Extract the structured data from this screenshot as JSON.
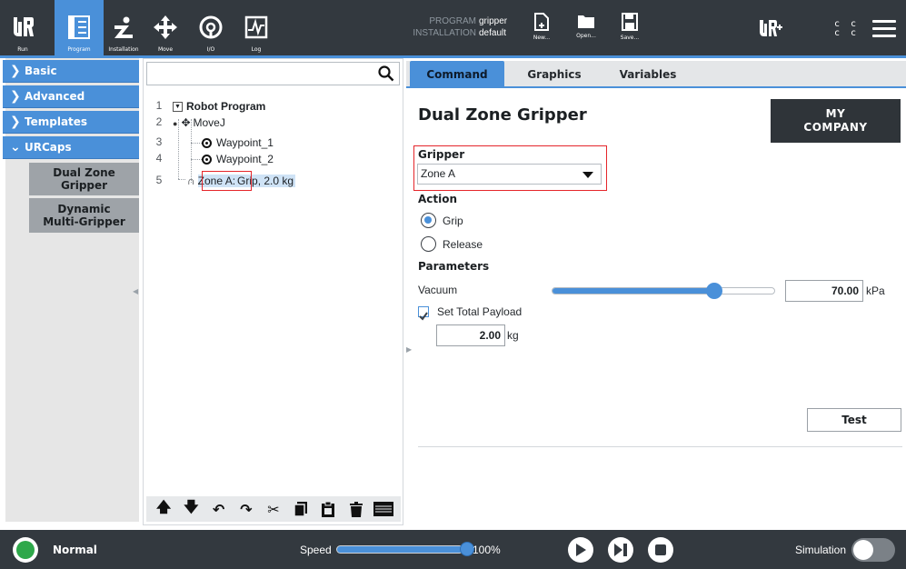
{
  "header": {
    "nav": [
      {
        "label": "Run",
        "icon": "ur-logo-icon"
      },
      {
        "label": "Program",
        "icon": "program-icon"
      },
      {
        "label": "Installation",
        "icon": "installation-icon"
      },
      {
        "label": "Move",
        "icon": "move-icon"
      },
      {
        "label": "I/O",
        "icon": "io-icon"
      },
      {
        "label": "Log",
        "icon": "log-icon"
      }
    ],
    "program_label": "PROGRAM",
    "program_value": "gripper",
    "installation_label": "INSTALLATION",
    "installation_value": "default",
    "file_buttons": [
      {
        "label": "New...",
        "icon": "new-file-icon"
      },
      {
        "label": "Open...",
        "icon": "open-folder-icon"
      },
      {
        "label": "Save...",
        "icon": "save-icon"
      }
    ],
    "cc_glyphs": [
      "c c",
      "c c"
    ]
  },
  "sidebar": {
    "categories": [
      {
        "label": "Basic",
        "expanded": false
      },
      {
        "label": "Advanced",
        "expanded": false
      },
      {
        "label": "Templates",
        "expanded": false
      },
      {
        "label": "URCaps",
        "expanded": true
      }
    ],
    "urcaps_items": [
      "Dual Zone Gripper",
      "Dynamic Multi-Gripper"
    ]
  },
  "tree": {
    "search_value": "",
    "rows": [
      {
        "num": "1",
        "text": "Robot Program"
      },
      {
        "num": "2",
        "text": "MoveJ"
      },
      {
        "num": "3",
        "text": "Waypoint_1"
      },
      {
        "num": "4",
        "text": "Waypoint_2"
      },
      {
        "num": "5",
        "zone_label": "Zone A:",
        "text": "Grip, 2.0 kg"
      }
    ]
  },
  "panel": {
    "tabs": [
      "Command",
      "Graphics",
      "Variables"
    ],
    "active_tab": "Command",
    "title": "Dual Zone Gripper",
    "logo_line1": "MY",
    "logo_line2": "COMPANY",
    "gripper_label": "Gripper",
    "gripper_value": "Zone A",
    "action_label": "Action",
    "action_options": [
      "Grip",
      "Release"
    ],
    "action_selected": "Grip",
    "parameters_label": "Parameters",
    "vacuum_label": "Vacuum",
    "vacuum_value": "70.00",
    "vacuum_unit": "kPa",
    "vacuum_slider_fraction": 0.73,
    "payload_label": "Set Total Payload",
    "payload_checked": true,
    "payload_value": "2.00",
    "payload_unit": "kg",
    "test_label": "Test"
  },
  "footer": {
    "status": "Normal",
    "speed_label": "Speed",
    "speed_value": "100%",
    "speed_fraction": 1.0,
    "simulation_label": "Simulation",
    "simulation_on": false
  },
  "colors": {
    "accent": "#4a90d9",
    "topbar": "#33393f",
    "highlight_box": "#e5262b",
    "status_green": "#2ea84a"
  }
}
